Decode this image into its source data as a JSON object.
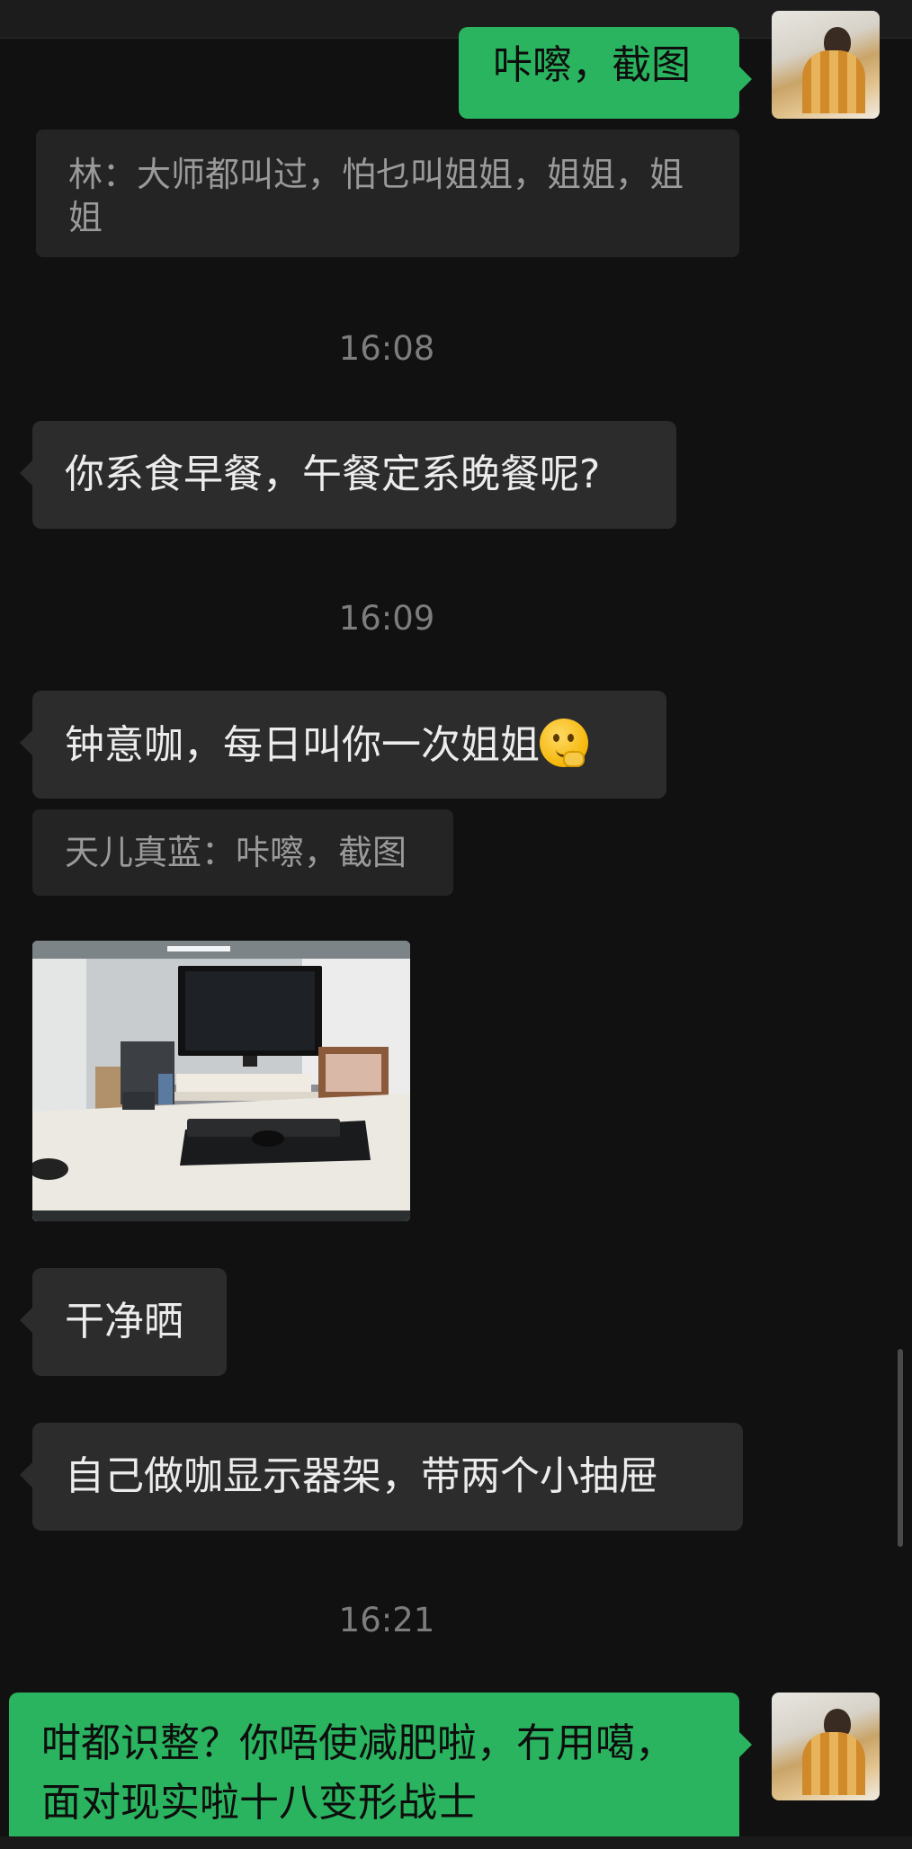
{
  "timestamps": [
    "16:08",
    "16:09",
    "16:21"
  ],
  "messages": {
    "m1": "咔嚓，截图",
    "q1": "林：大师都叫过，怕乜叫姐姐，姐姐，姐姐",
    "m2": "你系食早餐，午餐定系晚餐呢?",
    "m3": "钟意咖，每日叫你一次姐姐",
    "q2": "天儿真蓝：咔嚓，截图",
    "m4": "干净晒",
    "m5": "自己做咖显示器架，带两个小抽屉",
    "m6": "咁都识整？你唔使减肥啦，冇用噶，面对现实啦十八变形战士"
  },
  "icons": {
    "emoji": "thinking-face-emoji",
    "avatar": "user-avatar"
  },
  "colors": {
    "background": "#111111",
    "incoming_bubble": "#2c2c2c",
    "outgoing_bubble": "#2bb45f",
    "quote_bubble": "#242424",
    "timestamp": "#7d7d7d"
  }
}
